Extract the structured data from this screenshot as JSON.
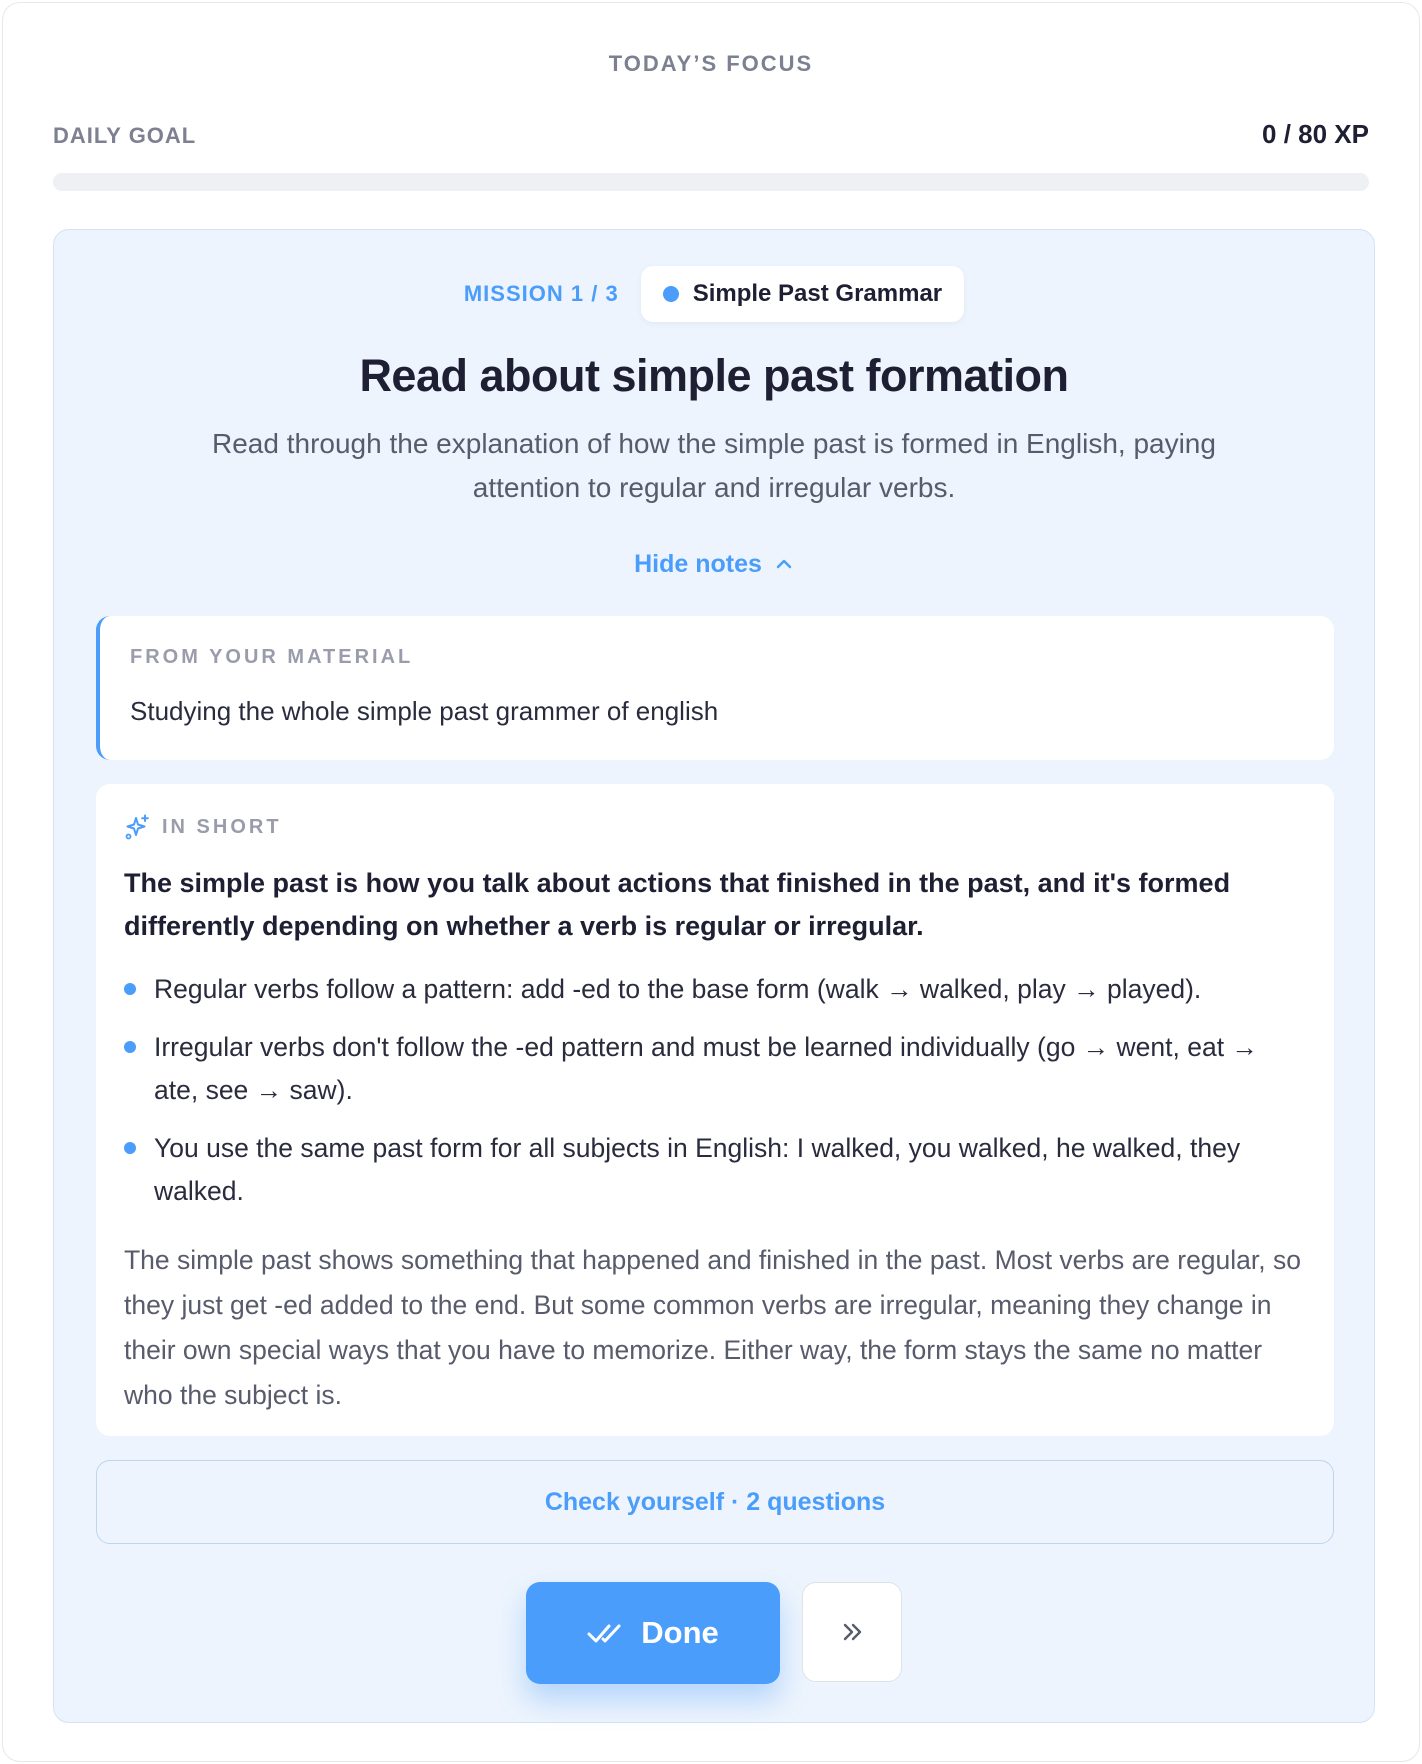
{
  "focus": {
    "title": "TODAY’S FOCUS"
  },
  "goal": {
    "label": "DAILY GOAL",
    "xp": "0 / 80 XP",
    "progress_fraction": 0
  },
  "mission": {
    "count": "MISSION 1 / 3",
    "topic": "Simple Past Grammar",
    "title": "Read about simple past formation",
    "description": "Read through the explanation of how the simple past is formed in English, paying attention to regular and irregular verbs.",
    "toggle_notes_label": "Hide notes"
  },
  "material": {
    "label": "FROM YOUR MATERIAL",
    "text": "Studying the whole simple past grammer of english"
  },
  "in_short": {
    "label": "IN SHORT",
    "lead": "The simple past is how you talk about actions that finished in the past, and it's formed differently depending on whether a verb is regular or irregular.",
    "bullets": [
      "Regular verbs follow a pattern: add -ed to the base form (walk → walked, play → played).",
      "Irregular verbs don't follow the -ed pattern and must be learned individually (go → went, eat → ate, see → saw).",
      "You use the same past form for all subjects in English: I walked, you walked, he walked, they walked."
    ],
    "paragraph": "The simple past shows something that happened and finished in the past. Most verbs are regular, so they just get -ed added to the end. But some common verbs are irregular, meaning they change in their own special ways that you have to memorize. Either way, the form stays the same no matter who the subject is."
  },
  "check": {
    "label": "Check yourself · 2 questions"
  },
  "actions": {
    "done_label": "Done",
    "done_icon": "double-check-icon",
    "skip_icon": "double-chevron-right-icon"
  },
  "colors": {
    "accent": "#4a9dfa",
    "card_bg": "#edf4fd",
    "text": "#1e1f33",
    "muted": "#7d8091"
  }
}
